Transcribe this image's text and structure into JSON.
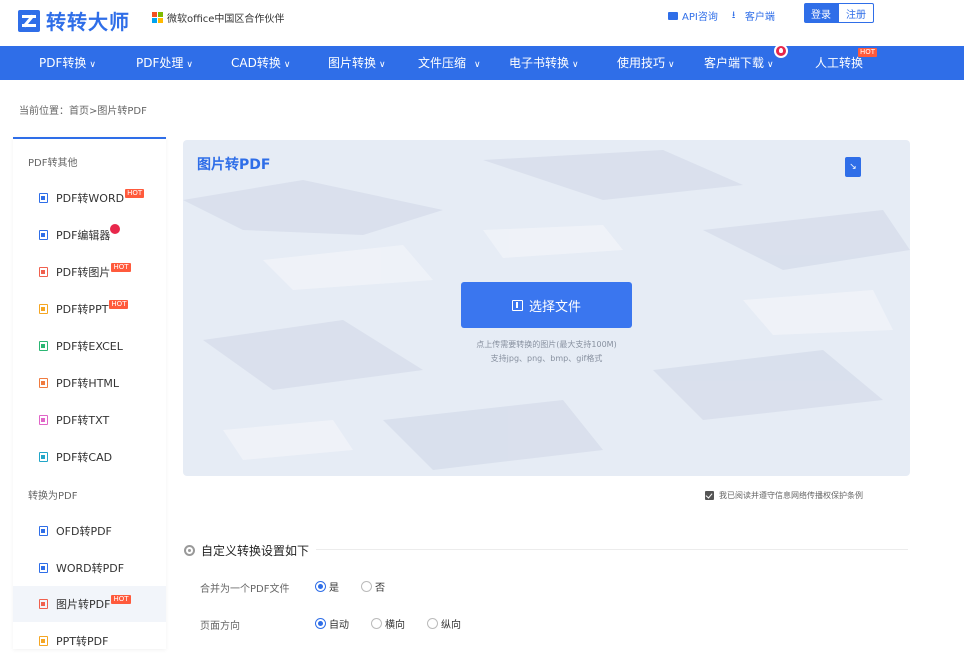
{
  "header": {
    "logo_text": "转转大师",
    "partner_text": "微软office中国区合作伙伴",
    "api_link": "API咨询",
    "client_link": "客户端",
    "login_label": "登录",
    "register_label": "注册"
  },
  "nav": {
    "items": [
      {
        "label": "PDF转换"
      },
      {
        "label": "PDF处理"
      },
      {
        "label": "CAD转换"
      },
      {
        "label": "图片转换"
      },
      {
        "label": "文件压缩"
      },
      {
        "label": "电子书转换"
      },
      {
        "label": "使用技巧"
      },
      {
        "label": "客户端下载"
      },
      {
        "label": "人工转换"
      }
    ],
    "hot_label": "HOT",
    "chevron": "∨"
  },
  "breadcrumb": "当前位置：首页>图片转PDF",
  "sidebar": {
    "group1": "PDF转其他",
    "group2": "转换为PDF",
    "items": [
      {
        "label": "PDF转WORD",
        "color": "#2f6ee8"
      },
      {
        "label": "PDF编辑器",
        "color": "#2f6ee8"
      },
      {
        "label": "PDF转图片",
        "color": "#f0604e"
      },
      {
        "label": "PDF转PPT",
        "color": "#f5a623"
      },
      {
        "label": "PDF转EXCEL",
        "color": "#2bb673"
      },
      {
        "label": "PDF转HTML",
        "color": "#f07b3f"
      },
      {
        "label": "PDF转TXT",
        "color": "#e066c8"
      },
      {
        "label": "PDF转CAD",
        "color": "#22a6c8"
      },
      {
        "label": "OFD转PDF",
        "color": "#2f6ee8"
      },
      {
        "label": "WORD转PDF",
        "color": "#2f6ee8"
      },
      {
        "label": "图片转PDF",
        "color": "#f0604e"
      },
      {
        "label": "PPT转PDF",
        "color": "#f5a623"
      }
    ],
    "hot_label": "HOT"
  },
  "upload": {
    "title": "图片转PDF",
    "choose_label": "选择文件",
    "hint_line1": "点上传需要转换的图片(最大支持100M)",
    "hint_line2": "支持jpg、png、bmp、gif格式",
    "agree_text": "我已阅读并遵守信息网络传播权保护条例"
  },
  "settings": {
    "title": "自定义转换设置如下",
    "merge_label": "合并为一个PDF文件",
    "merge_yes": "是",
    "merge_no": "否",
    "orient_label": "页面方向",
    "orient_auto": "自动",
    "orient_landscape": "横向",
    "orient_portrait": "纵向"
  },
  "colors": {
    "brand": "#2f6ee8",
    "hot": "#ff5a3c",
    "fire": "#e8274b"
  }
}
